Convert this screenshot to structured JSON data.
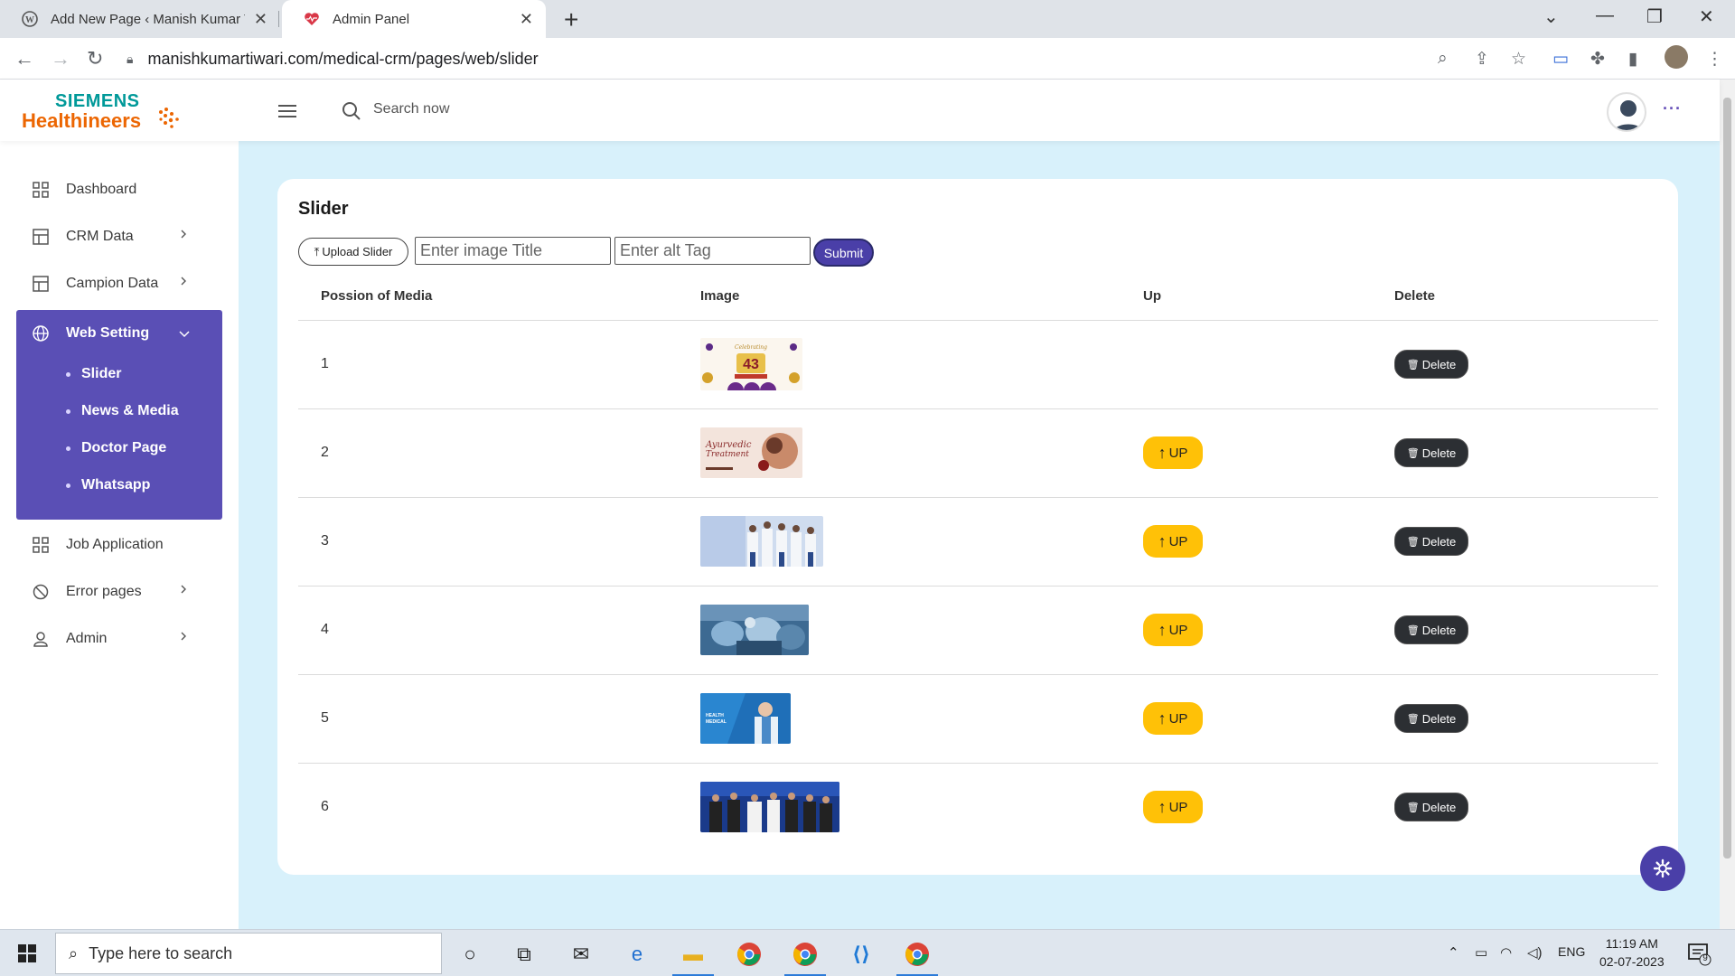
{
  "browser": {
    "tabs": [
      {
        "title": "Add New Page ‹ Manish Kumar Tiwari — WordPress",
        "active": false
      },
      {
        "title": "Admin Panel",
        "active": true
      }
    ],
    "url": "manishkumartiwari.com/medical-crm/pages/web/slider"
  },
  "header": {
    "logo_line1": "SIEMENS",
    "logo_line2": "Healthineers",
    "search_placeholder": "Search now",
    "more_label": "···"
  },
  "sidebar": {
    "items": [
      {
        "label": "Dashboard",
        "icon": "grid-icon",
        "has_children": false
      },
      {
        "label": "CRM Data",
        "icon": "table-icon",
        "has_children": true
      },
      {
        "label": "Campion Data",
        "icon": "table-icon",
        "has_children": true
      },
      {
        "label": "Web Setting",
        "icon": "globe-icon",
        "has_children": true,
        "expanded": true,
        "children": [
          "Slider",
          "News & Media",
          "Doctor Page",
          "Whatsapp"
        ]
      },
      {
        "label": "Job Application",
        "icon": "grid-icon",
        "has_children": false
      },
      {
        "label": "Error pages",
        "icon": "ban-icon",
        "has_children": true
      },
      {
        "label": "Admin",
        "icon": "user-icon",
        "has_children": true
      }
    ]
  },
  "page": {
    "title": "Slider",
    "upload_label": "Upload Slider",
    "title_placeholder": "Enter image Title",
    "alt_placeholder": "Enter alt Tag",
    "submit_label": "Submit",
    "columns": [
      "Possion of Media",
      "Image",
      "Up",
      "Delete"
    ],
    "rows": [
      {
        "position": "1",
        "image": "celebrating-43-years-banner",
        "has_up": false
      },
      {
        "position": "2",
        "image": "ayurvedic-treatment-banner",
        "has_up": true
      },
      {
        "position": "3",
        "image": "doctors-team-banner",
        "has_up": true
      },
      {
        "position": "4",
        "image": "surgery-team-banner",
        "has_up": true
      },
      {
        "position": "5",
        "image": "health-medical-banner",
        "has_up": true
      },
      {
        "position": "6",
        "image": "award-ceremony-banner",
        "has_up": true
      }
    ],
    "up_label": "UP",
    "delete_label": "Delete"
  },
  "taskbar": {
    "search_placeholder": "Type here to search",
    "language": "ENG",
    "time": "11:19 AM",
    "date": "02-07-2023",
    "notification_count": "9"
  },
  "colors": {
    "brand_purple": "#5a4fb5",
    "main_bg": "#d8f1fb",
    "up_yellow": "#ffc107",
    "delete_dark": "#2c2f33",
    "siemens_teal": "#009999",
    "healthineers_orange": "#ec6602"
  }
}
